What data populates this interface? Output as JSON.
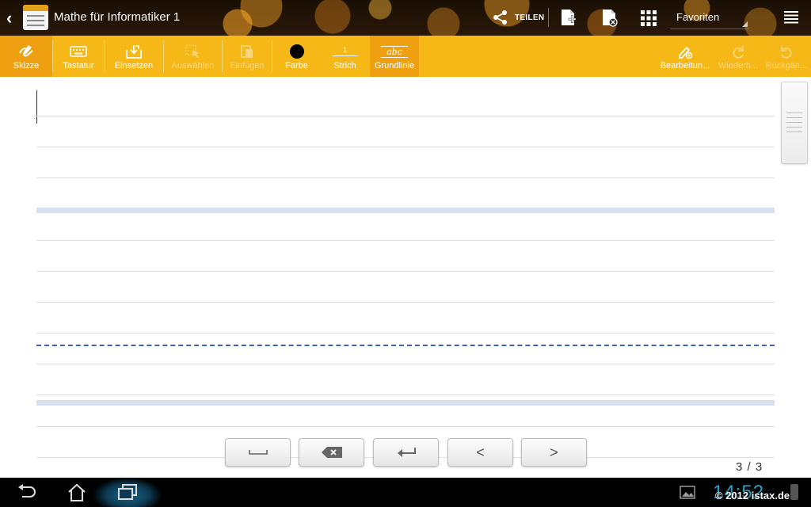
{
  "topbar": {
    "title": "Mathe für Informatiker 1",
    "share_label": "TEILEN",
    "favorites_label": "Favoriten"
  },
  "toolbar": {
    "tools": [
      {
        "label": "Skizze",
        "icon": "pen-sketch-icon",
        "state": "active"
      },
      {
        "label": "Tastatur",
        "icon": "keyboard-icon",
        "state": "normal"
      },
      {
        "label": "Einsetzen",
        "icon": "insert-icon",
        "state": "normal"
      },
      {
        "label": "Auswählen",
        "icon": "select-icon",
        "state": "disabled"
      },
      {
        "label": "Einfügen",
        "icon": "paste-icon",
        "state": "disabled"
      },
      {
        "label": "Farbe",
        "icon": "color-dot-icon",
        "state": "normal"
      },
      {
        "label": "Strich",
        "icon": "stroke-icon",
        "stroke_value": "1",
        "state": "normal"
      },
      {
        "label": "Grundlinie",
        "icon": "baseline-icon",
        "baseline_sample": "abc",
        "state": "active"
      }
    ],
    "right_tools": [
      {
        "label": "Bearbeitun...",
        "icon": "edit-mode-icon",
        "state": "normal"
      },
      {
        "label": "Wiederh...",
        "icon": "redo-icon",
        "state": "disabled"
      },
      {
        "label": "Rückgän...",
        "icon": "undo-icon",
        "state": "disabled"
      }
    ],
    "colors": {
      "bar": "#f5b817",
      "active": "#eea011",
      "current_color": "#000000"
    }
  },
  "keyboard_keys": [
    {
      "name": "space-key",
      "glyph": "␣"
    },
    {
      "name": "backspace-key",
      "glyph": "⌫"
    },
    {
      "name": "enter-key",
      "glyph": "↵"
    },
    {
      "name": "prev-key",
      "glyph": "<"
    },
    {
      "name": "next-key",
      "glyph": ">"
    }
  ],
  "page_indicator": "3 / 3",
  "statusbar": {
    "clock": "14:52",
    "watermark": "© 2012 istax.de"
  }
}
